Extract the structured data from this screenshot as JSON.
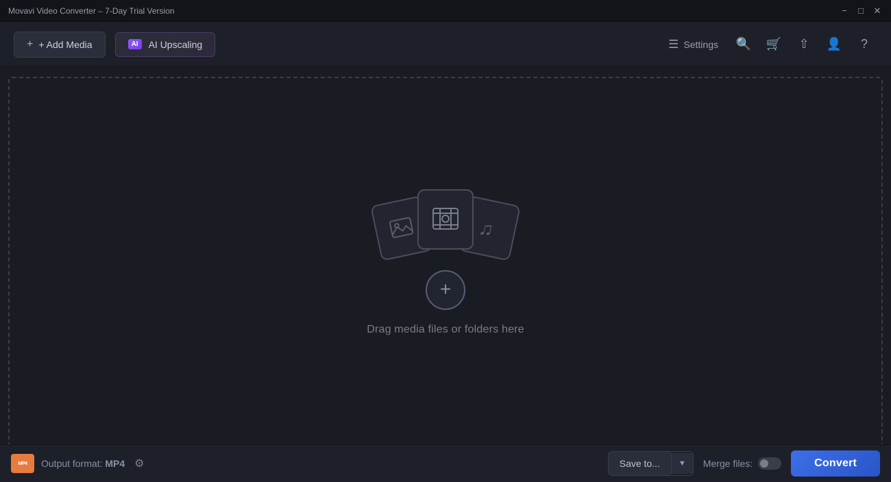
{
  "titleBar": {
    "title": "Movavi Video Converter – 7-Day Trial Version"
  },
  "toolbar": {
    "addMedia": "+ Add Media",
    "aiUpscaling": "AI Upscaling",
    "settings": "Settings"
  },
  "dropZone": {
    "dragText": "Drag media files or folders here"
  },
  "bottomBar": {
    "outputLabel": "Output format: ",
    "formatName": "MP4",
    "saveTo": "Save to...",
    "mergeFiles": "Merge files:",
    "convert": "Convert"
  }
}
